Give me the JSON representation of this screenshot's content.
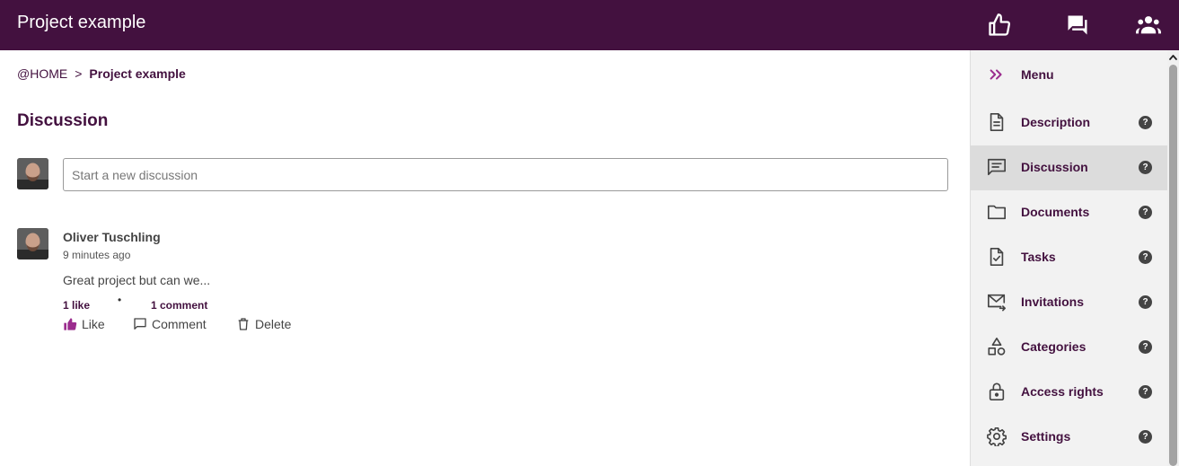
{
  "header": {
    "title": "Project example",
    "icons": [
      "thumbs-up-icon",
      "chat-icon",
      "group-icon"
    ],
    "background_color": "#43113f"
  },
  "breadcrumb": {
    "home": "@HOME",
    "separator": ">",
    "current": "Project example"
  },
  "main": {
    "heading": "Discussion",
    "new_discussion_placeholder": "Start a new discussion"
  },
  "post": {
    "author": "Oliver Tuschling",
    "time": "9 minutes ago",
    "text": "Great project but can we...",
    "likes": "1 like",
    "dot": "•",
    "comments": "1 comment",
    "actions": {
      "like": "Like",
      "comment": "Comment",
      "delete": "Delete"
    }
  },
  "sidebar": {
    "items": [
      {
        "label": "Menu",
        "icon": "double-chevron-right-icon"
      },
      {
        "label": "Description",
        "icon": "document-icon",
        "help": "?"
      },
      {
        "label": "Discussion",
        "icon": "chat-icon",
        "help": "?",
        "active": true
      },
      {
        "label": "Documents",
        "icon": "folder-icon",
        "help": "?"
      },
      {
        "label": "Tasks",
        "icon": "task-icon",
        "help": "?"
      },
      {
        "label": "Invitations",
        "icon": "mail-icon",
        "help": "?"
      },
      {
        "label": "Categories",
        "icon": "shapes-icon",
        "help": "?"
      },
      {
        "label": "Access rights",
        "icon": "lock-icon",
        "help": "?"
      },
      {
        "label": "Settings",
        "icon": "gear-icon",
        "help": "?"
      }
    ]
  },
  "colors": {
    "brand": "#43113f",
    "accent": "#9b2d8e",
    "sidebar_bg": "#f2f2f2",
    "active_bg": "#dcdcdc"
  }
}
